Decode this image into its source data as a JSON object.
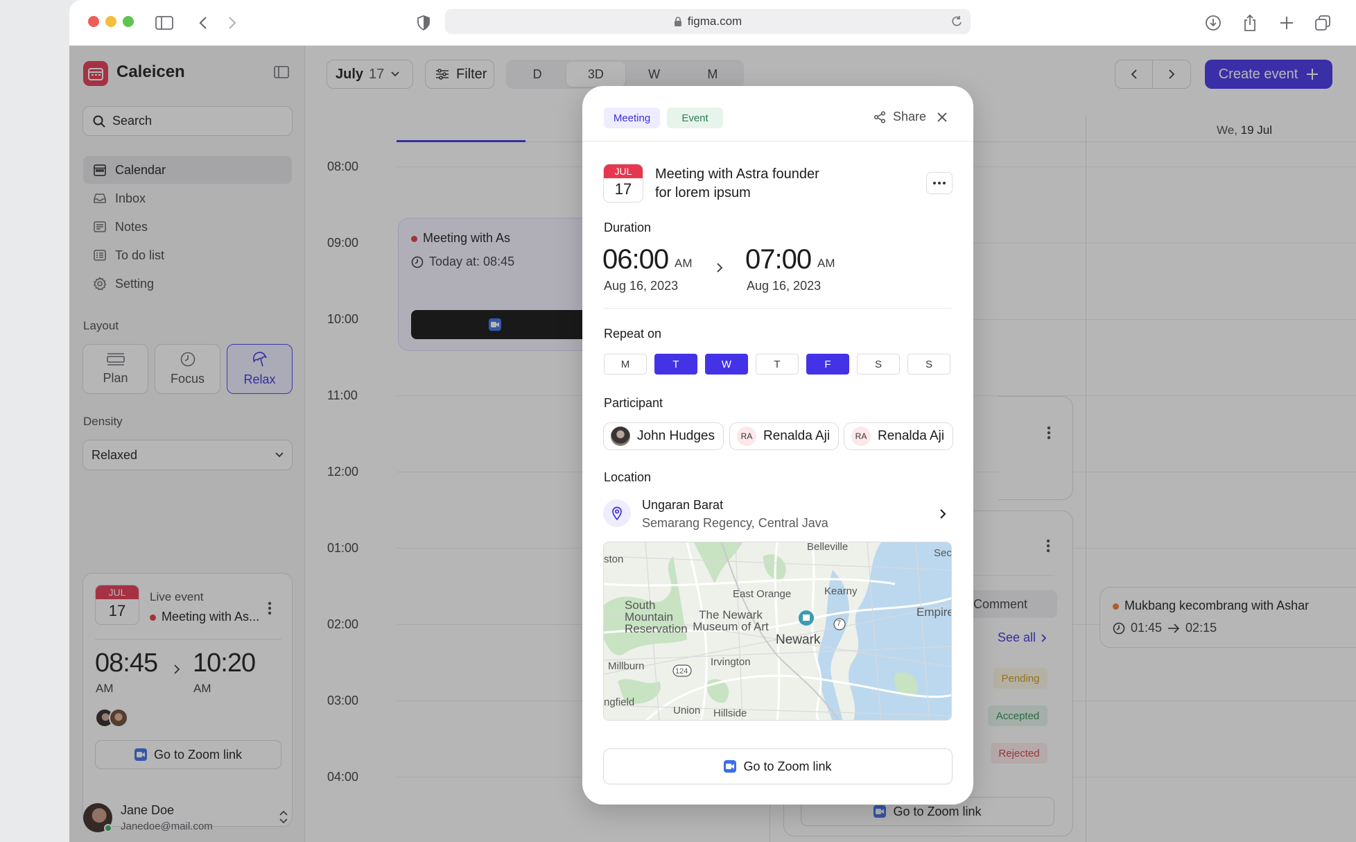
{
  "browser": {
    "url": "figma.com"
  },
  "app": {
    "name": "Caleicen"
  },
  "sidebar": {
    "search_placeholder": "Search",
    "nav": [
      {
        "label": "Calendar",
        "icon": "calendar-icon",
        "active": true
      },
      {
        "label": "Inbox",
        "icon": "inbox-icon"
      },
      {
        "label": "Notes",
        "icon": "notes-icon"
      },
      {
        "label": "To do list",
        "icon": "list-icon"
      },
      {
        "label": "Setting",
        "icon": "gear-icon"
      }
    ],
    "layout_label": "Layout",
    "layout_options": [
      {
        "label": "Plan",
        "icon": "plan-icon"
      },
      {
        "label": "Focus",
        "icon": "clock-icon"
      },
      {
        "label": "Relax",
        "icon": "umbrella-icon",
        "active": true
      }
    ],
    "density_label": "Density",
    "density_value": "Relaxed",
    "live_event": {
      "month": "JUL",
      "day": "17",
      "label": "Live event",
      "title": "Meeting with As...",
      "start": "08:45",
      "start_ampm": "AM",
      "end": "10:20",
      "end_ampm": "AM",
      "zoom_label": "Go to Zoom link"
    },
    "user": {
      "name": "Jane Doe",
      "email": "Janedoe@mail.com"
    }
  },
  "toolbar": {
    "date_month": "July",
    "date_day": "17",
    "filter_label": "Filter",
    "views": [
      "D",
      "3D",
      "W",
      "M"
    ],
    "active_view": "3D",
    "create_label": "Create event"
  },
  "calendar": {
    "hours": [
      "08:00",
      "09:00",
      "10:00",
      "11:00",
      "12:00",
      "01:00",
      "02:00",
      "03:00",
      "04:00"
    ],
    "column_header": {
      "day_prefix": "We,",
      "day_date": "19 Jul"
    },
    "bg_event_1": {
      "title": "Meeting with As",
      "time": "Today at: 08:45"
    },
    "bg_event_3": {
      "comment_label": "Comment",
      "see_all": "See all",
      "statuses": [
        "Pending",
        "Accepted",
        "Rejected"
      ],
      "zoom_label": "Go to Zoom link"
    },
    "bg_event_4": {
      "title": "Mukbang kecombrang with Ashar",
      "start": "01:45",
      "end": "02:15"
    }
  },
  "modal": {
    "tags": [
      "Meeting",
      "Event"
    ],
    "share_label": "Share",
    "month": "JUL",
    "day": "17",
    "title_line1": "Meeting with Astra founder",
    "title_line2": "for lorem ipsum",
    "duration_label": "Duration",
    "start_time": "06:00",
    "start_ampm": "AM",
    "start_date": "Aug 16, 2023",
    "end_time": "07:00",
    "end_ampm": "AM",
    "end_date": "Aug 16, 2023",
    "repeat_label": "Repeat on",
    "repeat_days": [
      {
        "label": "M",
        "on": false
      },
      {
        "label": "T",
        "on": true
      },
      {
        "label": "W",
        "on": true
      },
      {
        "label": "T",
        "on": false
      },
      {
        "label": "F",
        "on": true
      },
      {
        "label": "S",
        "on": false
      },
      {
        "label": "S",
        "on": false
      }
    ],
    "participant_label": "Participant",
    "participants": [
      {
        "name": "John Hudges",
        "initials": ""
      },
      {
        "name": "Renalda Aji",
        "initials": "RA"
      },
      {
        "name": "Renalda Aji",
        "initials": "RA"
      }
    ],
    "location_label": "Location",
    "location_name": "Ungaran Barat",
    "location_sub": "Semarang Regency, Central Java",
    "map_labels": [
      "Belleville",
      "ston",
      "Seca",
      "East Orange",
      "Kearny",
      "South Mountain Reservation",
      "The Newark Museum of Art",
      "Empire",
      "Newark",
      "Millburn",
      "Irvington",
      "124",
      "7",
      "ngfield",
      "Union",
      "Hillside"
    ],
    "zoom_label": "Go to Zoom link"
  },
  "colors": {
    "accent": "#4433e6",
    "brand_red": "#e5384f",
    "tag_meeting_bg": "#eeedff",
    "tag_event_bg": "#e7f4ec"
  }
}
